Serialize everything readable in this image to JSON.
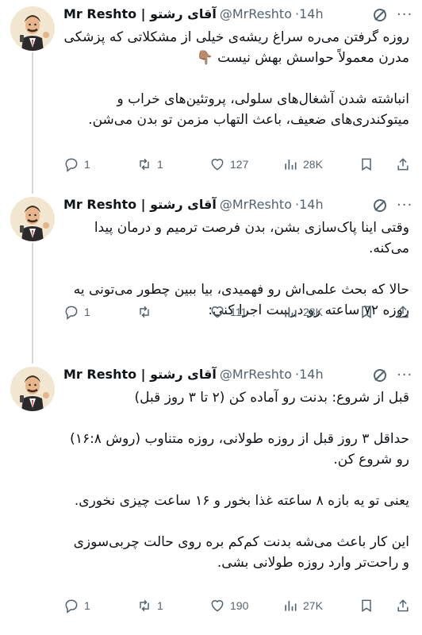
{
  "tweets": [
    {
      "name": "Mr Reshto | آقای رشتو",
      "handle": "@MrReshto",
      "time": "14h",
      "text": "روزه گرفتن می‌ره سراغ ریشه‌ی خیلی از مشکلاتی که پزشکی مدرن معمولاً حواسش بهش نیست 👇🏽\n\nانباشته شدن آشغال‌های سلولی، پروتئین‌های خراب و میتوکندری‌های ضعیف، باعث التهاب مزمن تو بدن می‌شن.",
      "replies": "1",
      "retweets": "1",
      "likes": "127",
      "views": "28K"
    },
    {
      "name": "Mr Reshto | آقای رشتو",
      "handle": "@MrReshto",
      "time": "14h",
      "text": "وقتی اینا پاک‌سازی بشن، بدن فرصت ترمیم و درمان پیدا می‌کنه.\n\nحالا که بحث علمی‌اش رو فهمیدی، بیا ببین چطور می‌تونی یه روزه ۷۲ ساعته رو درست اجرا کنی:",
      "replies": "1",
      "retweets": "",
      "likes": "111",
      "views": "28K"
    },
    {
      "name": "Mr Reshto | آقای رشتو",
      "handle": "@MrReshto",
      "time": "14h",
      "text": "قبل از شروع: بدنت رو آماده کن (۲ تا ۳ روز قبل)\n\nحداقل ۳ روز قبل از روزه طولانی، روزه متناوب (روش ۱۶:۸) رو شروع کن.\n\nیعنی تو یه بازه ۸ ساعته غذا بخور و ۱۶ ساعت چیزی نخوری.\n\nاین کار باعث می‌شه بدنت کم‌کم بره روی حالت چربی‌سوزی و راحت‌تر وارد روزه طولانی بشی.",
      "replies": "1",
      "retweets": "1",
      "likes": "190",
      "views": "27K"
    }
  ],
  "separator": "·",
  "icons": {
    "reply": "reply-icon",
    "retweet": "retweet-icon",
    "like": "heart-icon",
    "views": "views-icon",
    "bookmark": "bookmark-icon",
    "share": "share-icon",
    "grok": "grok-icon",
    "more": "more-icon"
  },
  "colors": {
    "text": "#0f1419",
    "secondary": "#536471",
    "thread": "#cfd9de"
  }
}
